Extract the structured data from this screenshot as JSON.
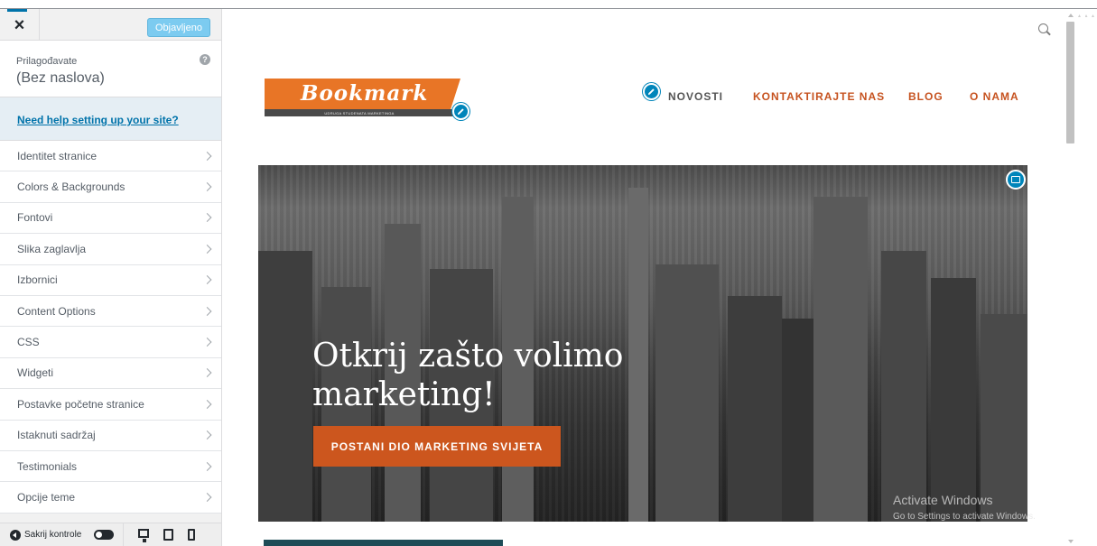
{
  "sidebar": {
    "close_glyph": "×",
    "publish_label": "Objavljeno",
    "info": {
      "label": "Prilagođavate",
      "title": "(Bez naslova)",
      "help_glyph": "?"
    },
    "help_link": "Need help setting up your site?",
    "items": [
      {
        "label": "Identitet stranice"
      },
      {
        "label": "Colors & Backgrounds"
      },
      {
        "label": "Fontovi"
      },
      {
        "label": "Slika zaglavlja"
      },
      {
        "label": "Izbornici"
      },
      {
        "label": "Content Options"
      },
      {
        "label": "CSS"
      },
      {
        "label": "Widgeti"
      },
      {
        "label": "Postavke početne stranice"
      },
      {
        "label": "Istaknuti sadržaj"
      },
      {
        "label": "Testimonials"
      },
      {
        "label": "Opcije teme"
      }
    ],
    "footer": {
      "hide_controls_label": "Sakrij kontrole",
      "devices": [
        "desktop-icon",
        "tablet-icon",
        "mobile-icon"
      ]
    }
  },
  "preview": {
    "logo": {
      "text": "Bookmark",
      "strip_text": "UDRUGA STUDENATA MARKETINGA"
    },
    "nav": {
      "items": [
        "NOVOSTI",
        "KONTAKTIRAJTE NAS",
        "BLOG",
        "O NAMA"
      ]
    },
    "hero": {
      "title_line1": "Otkrij zašto volimo",
      "title_line2": "marketing!",
      "cta_label": "POSTANI DIO MARKETING SVIJETA"
    },
    "watermark": {
      "title": "Activate Windows",
      "subtitle": "Go to Settings to activate Windows."
    }
  },
  "colors": {
    "accent_blue": "#0085ba",
    "publish_button": "#7ccbf0",
    "nav_orange": "#c6521f",
    "cta_orange": "#cc561e",
    "logo_orange": "#e87526",
    "teal": "#1e4c57"
  }
}
